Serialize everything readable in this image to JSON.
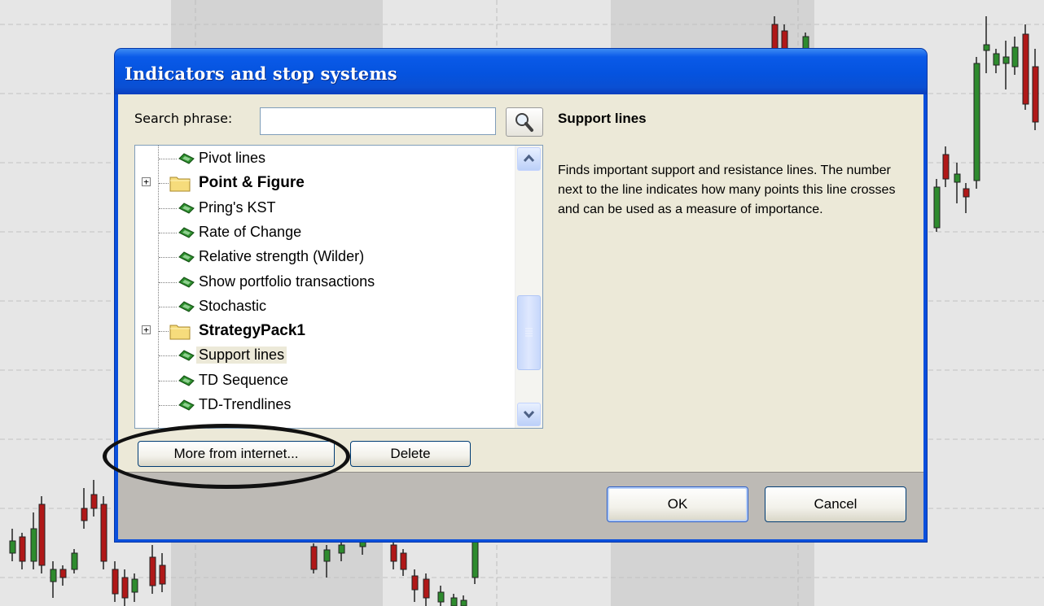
{
  "dialog": {
    "title": "Indicators and stop systems",
    "search_label": "Search phrase:",
    "search_value": "",
    "tree_items": [
      {
        "label": "Pivot lines",
        "type": "leaf"
      },
      {
        "label": "Point & Figure",
        "type": "folder"
      },
      {
        "label": "Pring's KST",
        "type": "leaf"
      },
      {
        "label": "Rate of Change",
        "type": "leaf"
      },
      {
        "label": "Relative strength (Wilder)",
        "type": "leaf"
      },
      {
        "label": "Show portfolio transactions",
        "type": "leaf"
      },
      {
        "label": "Stochastic",
        "type": "leaf"
      },
      {
        "label": "StrategyPack1",
        "type": "folder"
      },
      {
        "label": "Support lines",
        "type": "leaf",
        "selected": true
      },
      {
        "label": "TD Sequence",
        "type": "leaf"
      },
      {
        "label": "TD-Trendlines",
        "type": "leaf"
      }
    ],
    "description_title": "Support lines",
    "description_text": "Finds important support and resistance lines. The number next to the line indicates how many points this line crosses and can be used as a measure of importance.",
    "more_button": "More from internet...",
    "delete_button": "Delete",
    "ok_button": "OK",
    "cancel_button": "Cancel"
  },
  "icons": {
    "search": "magnifier-icon",
    "leaf": "indicator-icon",
    "folder": "folder-icon",
    "expand": "plus-icon",
    "scroll_up": "chevron-up-icon",
    "scroll_down": "chevron-down-icon"
  },
  "colors": {
    "title_bar": "#0553df",
    "dialog_bg": "#ece9d8",
    "footer_bg": "#bdbab5",
    "candle_up": "#2e8b2e",
    "candle_down": "#b01818"
  }
}
